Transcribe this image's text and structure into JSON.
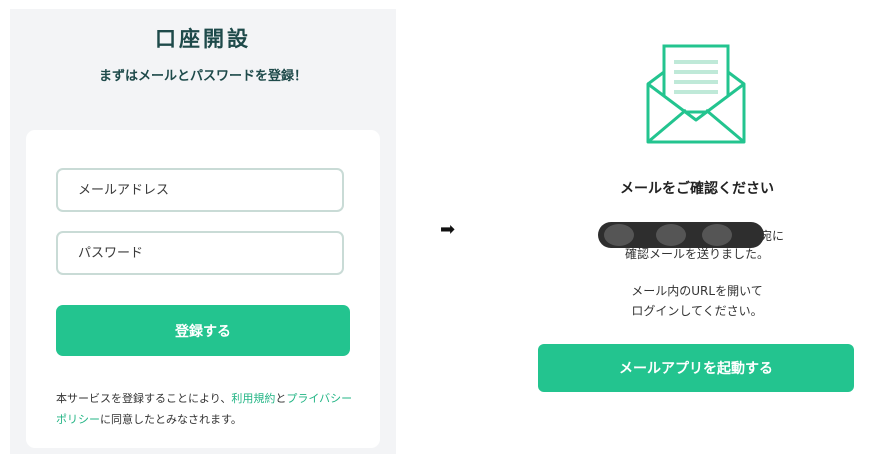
{
  "signup": {
    "title": "口座開設",
    "subtitle": "まずはメールとパスワードを登録！",
    "email_placeholder": "メールアドレス",
    "password_placeholder": "パスワード",
    "register_label": "登録する",
    "terms_prefix": "本サービスを登録することにより、",
    "terms_link": "利用規約",
    "terms_and": "と",
    "privacy_link": "プライバシーポリシー",
    "terms_suffix": "に同意したとみなされます。"
  },
  "arrow": "➡",
  "confirmation": {
    "icon": "envelope-letter-icon",
    "title": "メールをご確認ください",
    "address_suffix": "宛に",
    "sent_line": "確認メールを送りました。",
    "instruction_line1": "メール内のURLを開いて",
    "instruction_line2": "ログインしてください。",
    "launch_label": "メールアプリを起動する"
  },
  "colors": {
    "accent": "#23c48f",
    "heading": "#1e4a4a",
    "panel_bg": "#f3f4f6",
    "field_border": "#c9dbd6"
  }
}
